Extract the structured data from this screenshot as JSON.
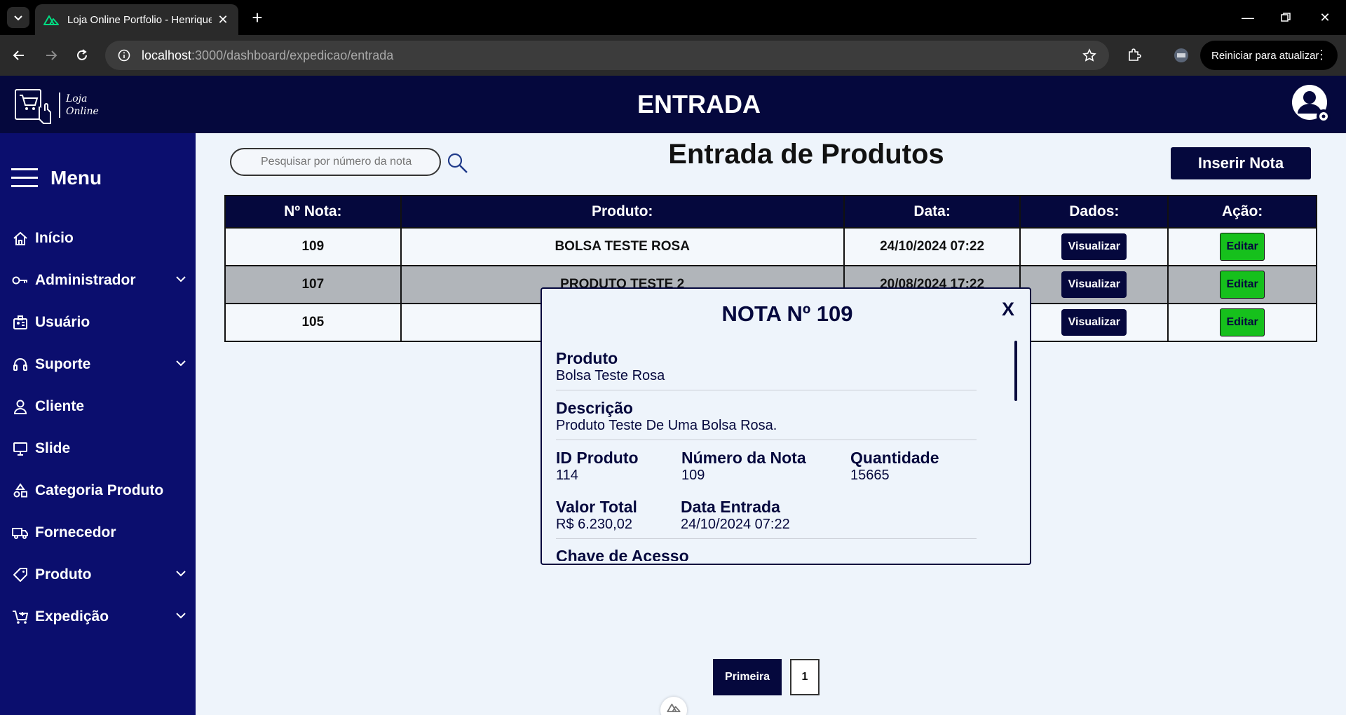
{
  "browser": {
    "tab_title": "Loja Online Portfolio - Henrique",
    "url_host": "localhost",
    "url_path": ":3000/dashboard/expedicao/entrada",
    "update_button": "Reiniciar para atualizar"
  },
  "header": {
    "logo_line1": "Loja",
    "logo_line2": "Online",
    "title": "ENTRADA"
  },
  "sidebar": {
    "menu_label": "Menu",
    "items": [
      {
        "label": "Início",
        "icon": "home-icon",
        "has_submenu": false
      },
      {
        "label": "Administrador",
        "icon": "key-icon",
        "has_submenu": true
      },
      {
        "label": "Usuário",
        "icon": "id-card-icon",
        "has_submenu": false
      },
      {
        "label": "Suporte",
        "icon": "headset-icon",
        "has_submenu": true
      },
      {
        "label": "Cliente",
        "icon": "person-icon",
        "has_submenu": false
      },
      {
        "label": "Slide",
        "icon": "monitor-icon",
        "has_submenu": false
      },
      {
        "label": "Categoria Produto",
        "icon": "shapes-icon",
        "has_submenu": false
      },
      {
        "label": "Fornecedor",
        "icon": "truck-icon",
        "has_submenu": false
      },
      {
        "label": "Produto",
        "icon": "tag-icon",
        "has_submenu": true
      },
      {
        "label": "Expedição",
        "icon": "cart-icon",
        "has_submenu": true
      }
    ]
  },
  "main": {
    "search_placeholder": "Pesquisar por número da nota",
    "title": "Entrada de Produtos",
    "insert_button": "Inserir Nota",
    "table": {
      "headers": [
        "Nº Nota:",
        "Produto:",
        "Data:",
        "Dados:",
        "Ação:"
      ],
      "rows": [
        {
          "nota": "109",
          "produto": "BOLSA TESTE ROSA",
          "data": "24/10/2024 07:22",
          "view": "Visualizar",
          "edit": "Editar"
        },
        {
          "nota": "107",
          "produto": "PRODUTO TESTE 2",
          "data": "20/08/2024 17:22",
          "view": "Visualizar",
          "edit": "Editar"
        },
        {
          "nota": "105",
          "produto": "",
          "data": "",
          "view": "Visualizar",
          "edit": "Editar"
        }
      ]
    },
    "pagination": {
      "first": "Primeira",
      "pages": [
        "1"
      ]
    }
  },
  "modal": {
    "title": "NOTA Nº 109",
    "close": "X",
    "produto_label": "Produto",
    "produto_value": "Bolsa Teste Rosa",
    "descricao_label": "Descrição",
    "descricao_value": "Produto Teste De Uma Bolsa Rosa.",
    "id_label": "ID Produto",
    "id_value": "114",
    "numero_label": "Número da Nota",
    "numero_value": "109",
    "quantidade_label": "Quantidade",
    "quantidade_value": "15665",
    "valor_label": "Valor Total",
    "valor_value": "R$ 6.230,02",
    "data_label": "Data Entrada",
    "data_value": "24/10/2024 07:22",
    "chave_label": "Chave de Acesso"
  },
  "colors": {
    "navy": "#05083d",
    "sidebar": "#0b0e6e",
    "edit_green": "#16c01c",
    "row_gray": "#b1b5ba",
    "page_bg": "#eef4fb"
  }
}
